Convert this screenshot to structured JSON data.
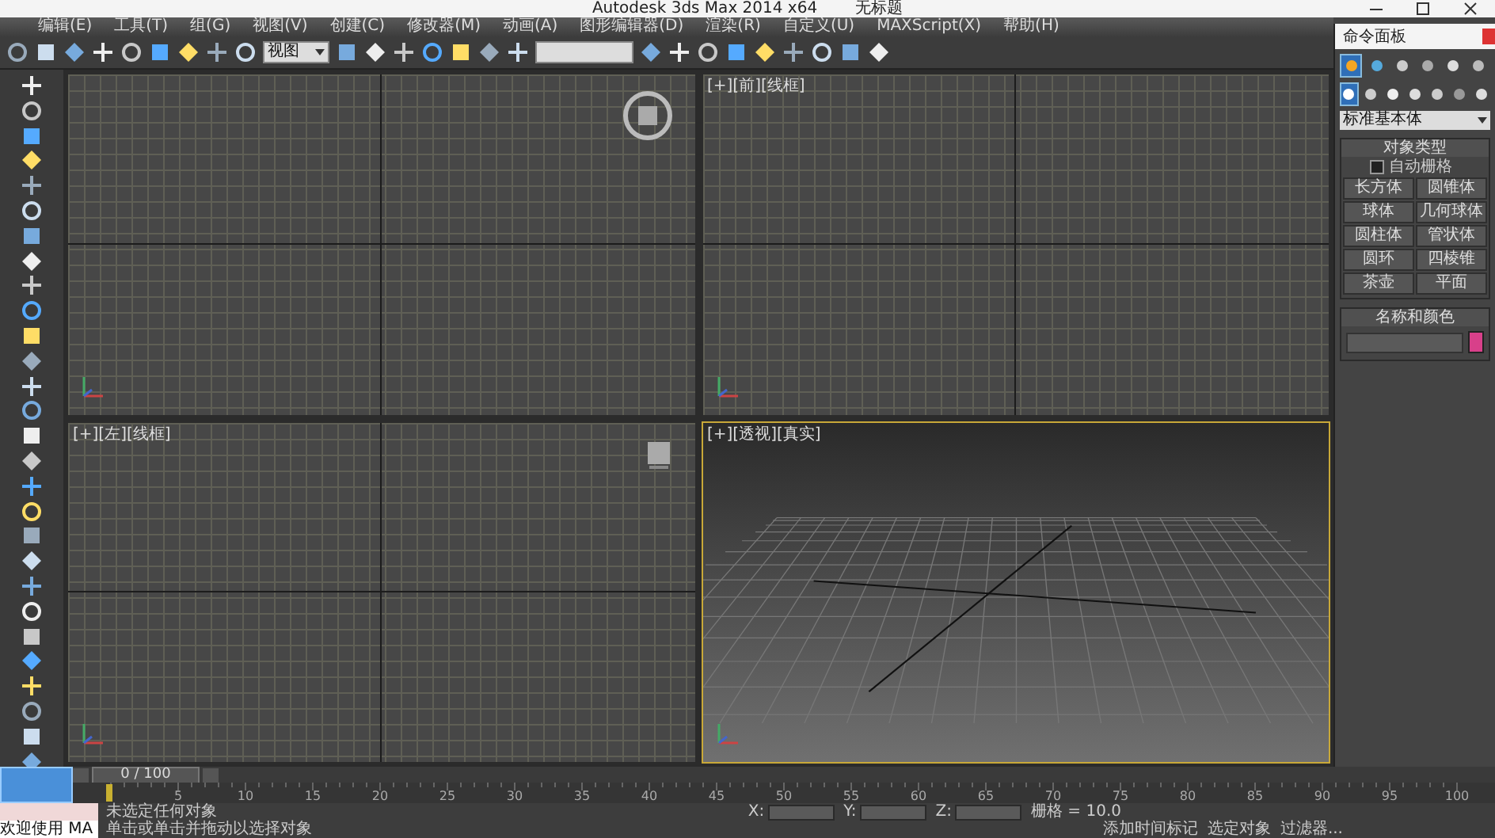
{
  "window": {
    "title": "Autodesk 3ds Max  2014 x64",
    "document": "无标题"
  },
  "menu": [
    "编辑(E)",
    "工具(T)",
    "组(G)",
    "视图(V)",
    "创建(C)",
    "修改器(M)",
    "动画(A)",
    "图形编辑器(D)",
    "渲染(R)",
    "自定义(U)",
    "MAXScript(X)",
    "帮助(H)"
  ],
  "toolbar": {
    "coordinate_system": "视图"
  },
  "viewports": [
    {
      "kind": "ortho",
      "viewcube": true,
      "hovered": true,
      "selected": false
    },
    {
      "kind": "ortho",
      "label": "[+][前][线框]",
      "selected": false
    },
    {
      "kind": "ortho",
      "label": "[+][左][线框]",
      "viewcube": true,
      "hovered": false,
      "selected": false
    },
    {
      "kind": "perspective",
      "label": "[+][透视][真实]",
      "selected": true
    }
  ],
  "command_panel": {
    "title": "命令面板",
    "tabs": [
      {
        "kind": "create",
        "selected": true
      },
      {
        "kind": "modify",
        "selected": false
      },
      {
        "kind": "hierarchy",
        "selected": false
      },
      {
        "kind": "motion",
        "selected": false
      },
      {
        "kind": "display",
        "selected": false
      },
      {
        "kind": "utilities",
        "selected": false
      }
    ],
    "categories": [
      {
        "kind": "geometry",
        "selected": true
      },
      {
        "kind": "shapes",
        "selected": false
      },
      {
        "kind": "lights",
        "selected": false
      },
      {
        "kind": "cameras",
        "selected": false
      },
      {
        "kind": "helpers",
        "selected": false
      },
      {
        "kind": "spacewarps",
        "selected": false
      },
      {
        "kind": "systems",
        "selected": false
      }
    ],
    "subcategory": "标准基本体",
    "object_type": {
      "title": "对象类型",
      "autogrid": {
        "label": "自动栅格",
        "checked": false
      },
      "buttons": [
        "长方体",
        "圆锥体",
        "球体",
        "几何球体",
        "圆柱体",
        "管状体",
        "圆环",
        "四棱锥",
        "茶壶",
        "平面"
      ]
    },
    "name_and_color": {
      "title": "名称和颜色",
      "color": "#d8408a"
    }
  },
  "time_slider": {
    "label": "0 / 100"
  },
  "track_bar": {
    "ticks": [
      "5",
      "10",
      "15",
      "20",
      "25",
      "30",
      "35",
      "40",
      "45",
      "50",
      "55",
      "60",
      "65",
      "70",
      "75",
      "80",
      "85",
      "90",
      "95",
      "100"
    ]
  },
  "status": {
    "listener": "欢迎使用 MA",
    "selection": "未选定任何对象",
    "prompt": "单击或单击并拖动以选择对象",
    "coords": [
      "X:",
      "Y:",
      "Z:"
    ],
    "grid": "栅格 = 10.0",
    "time_tag": "添加时间标记",
    "key_set": "选定对象",
    "key_filters": "过滤器..."
  }
}
